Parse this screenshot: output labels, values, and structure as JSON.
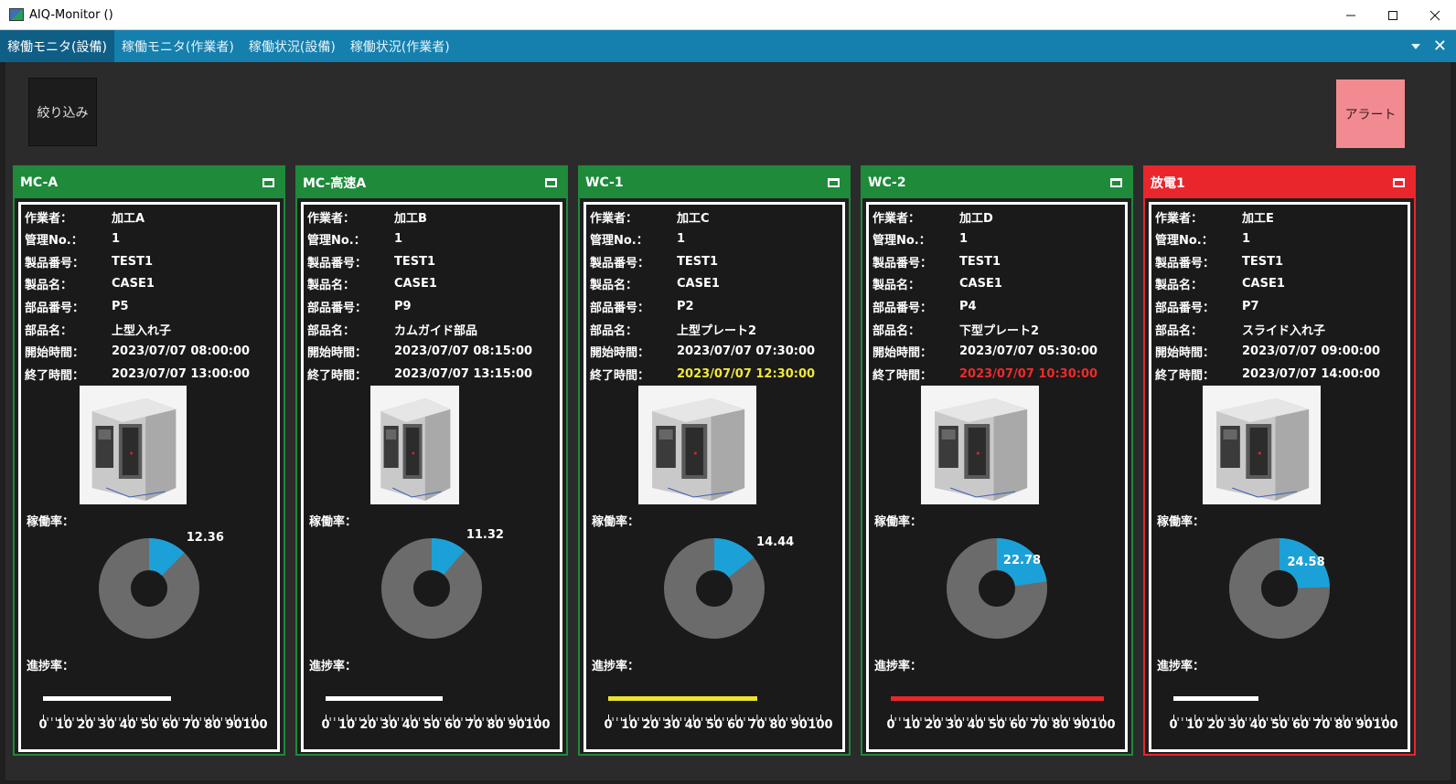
{
  "window": {
    "title": "AIQ-Monitor ()"
  },
  "tabs": [
    {
      "label": "稼働モニタ(設備)"
    },
    {
      "label": "稼働モニタ(作業者)"
    },
    {
      "label": "稼働状況(設備)"
    },
    {
      "label": "稼働状況(作業者)"
    }
  ],
  "toolbar": {
    "filter_label": "絞り込み",
    "alert_label": "アラート"
  },
  "labels": {
    "worker": "作業者：",
    "mgmt_no": "管理No.：",
    "product_no": "製品番号：",
    "product_name": "製品名：",
    "part_no": "部品番号：",
    "part_name": "部品名：",
    "start_time": "開始時間：",
    "end_time": "終了時間：",
    "utilization": "稼働率：",
    "progress": "進捗率："
  },
  "axis_ticks": [
    "0",
    "10",
    "20",
    "30",
    "40",
    "50",
    "60",
    "70",
    "80",
    "90",
    "100"
  ],
  "colors": {
    "ok": "#1e8a3a",
    "alert": "#e8262c",
    "warn_text": "#f1e83a",
    "err_text": "#f02a2a",
    "donut_fill": "#1ba1d8",
    "donut_track": "#6b6b6b"
  },
  "machines": [
    {
      "name": "MC-A",
      "status": "ok",
      "worker": "加工A",
      "mgmt_no": "1",
      "product_no": "TEST1",
      "product_name": "CASE1",
      "part_no": "P5",
      "part_name": "上型入れ子",
      "start": "2023/07/07 08:00:00",
      "end": "2023/07/07 13:00:00",
      "end_state": "normal",
      "utilization": "12.36",
      "progress": 60,
      "progress_color": "#ffffff"
    },
    {
      "name": "MC-高速A",
      "status": "ok",
      "worker": "加工B",
      "mgmt_no": "1",
      "product_no": "TEST1",
      "product_name": "CASE1",
      "part_no": "P9",
      "part_name": "カムガイド部品",
      "start": "2023/07/07 08:15:00",
      "end": "2023/07/07 13:15:00",
      "end_state": "normal",
      "utilization": "11.32",
      "progress": 55,
      "progress_color": "#ffffff"
    },
    {
      "name": "WC-1",
      "status": "ok",
      "worker": "加工C",
      "mgmt_no": "1",
      "product_no": "TEST1",
      "product_name": "CASE1",
      "part_no": "P2",
      "part_name": "上型プレート2",
      "start": "2023/07/07 07:30:00",
      "end": "2023/07/07 12:30:00",
      "end_state": "warn",
      "utilization": "14.44",
      "progress": 70,
      "progress_color": "#e8e42f"
    },
    {
      "name": "WC-2",
      "status": "ok",
      "worker": "加工D",
      "mgmt_no": "1",
      "product_no": "TEST1",
      "product_name": "CASE1",
      "part_no": "P4",
      "part_name": "下型プレート2",
      "start": "2023/07/07 05:30:00",
      "end": "2023/07/07 10:30:00",
      "end_state": "err",
      "utilization": "22.78",
      "progress": 100,
      "progress_color": "#e8262c"
    },
    {
      "name": "放電1",
      "status": "alert",
      "worker": "加工E",
      "mgmt_no": "1",
      "product_no": "TEST1",
      "product_name": "CASE1",
      "part_no": "P7",
      "part_name": "スライド入れ子",
      "start": "2023/07/07 09:00:00",
      "end": "2023/07/07 14:00:00",
      "end_state": "normal",
      "utilization": "24.58",
      "progress": 40,
      "progress_color": "#ffffff"
    }
  ]
}
